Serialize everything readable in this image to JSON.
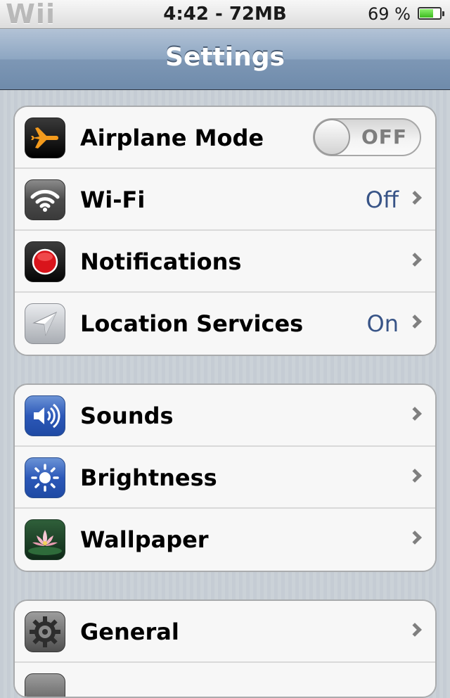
{
  "status_bar": {
    "carrier": "Wii",
    "clock": "4:42 - 72MB",
    "battery_percent": "69 %",
    "battery_level": 0.69
  },
  "nav": {
    "title": "Settings"
  },
  "groups": [
    {
      "rows": [
        {
          "label": "Airplane Mode",
          "icon": "airplane-icon",
          "toggle": "OFF"
        },
        {
          "label": "Wi-Fi",
          "icon": "wifi-icon",
          "value": "Off"
        },
        {
          "label": "Notifications",
          "icon": "notifications-icon"
        },
        {
          "label": "Location Services",
          "icon": "location-icon",
          "value": "On"
        }
      ]
    },
    {
      "rows": [
        {
          "label": "Sounds",
          "icon": "speaker-icon"
        },
        {
          "label": "Brightness",
          "icon": "sun-icon"
        },
        {
          "label": "Wallpaper",
          "icon": "flower-icon"
        }
      ]
    },
    {
      "rows": [
        {
          "label": "General",
          "icon": "gear-icon"
        }
      ]
    }
  ],
  "colors": {
    "value_text": "#385487",
    "airplane_orange": "#f39a1c",
    "notification_red": "#d9141b",
    "nav_blue": "#7d97b5"
  }
}
